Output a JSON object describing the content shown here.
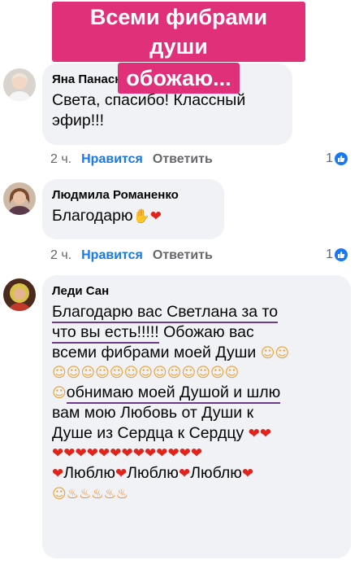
{
  "banner": {
    "line1": "Всеми фибрами души",
    "line2": "обожаю..."
  },
  "comments": [
    {
      "author": "Яна Панасюченко",
      "text_line1": "Света, спасибо! Классный",
      "text_line2": "эфир!!!",
      "time": "2 ч.",
      "like_label": "Нравится",
      "reply_label": "Ответить",
      "reactions": "1"
    },
    {
      "author": "Людмила Романенко",
      "text": "Благодарю",
      "time": "2 ч.",
      "like_label": "Нравится",
      "reply_label": "Ответить",
      "reactions": "1"
    },
    {
      "author": "Леди Сан",
      "line1": "Благодарю вас Светлана за то",
      "line2a": "что вы есть!!!!!",
      "line2b": " Обожаю вас",
      "line3": "всеми фибрами моей Души ",
      "line5": "обнимаю моей Душой и шлю",
      "line6": "вам мою Любовь от Души к",
      "line7": "Душе из Сердца к Сердцу ",
      "love": "Люблю"
    }
  ],
  "icons": {
    "like": "thumbs-up-icon",
    "heart": "heart-emoji",
    "pray": "praying-hands-emoji",
    "blush": "smiling-face-with-hearts-emoji",
    "flame": "fire-emoji"
  },
  "colors": {
    "banner": "#e0307a",
    "link": "#1877f2",
    "bubble": "#f0f2f5",
    "underline": "#6d3a8c"
  }
}
